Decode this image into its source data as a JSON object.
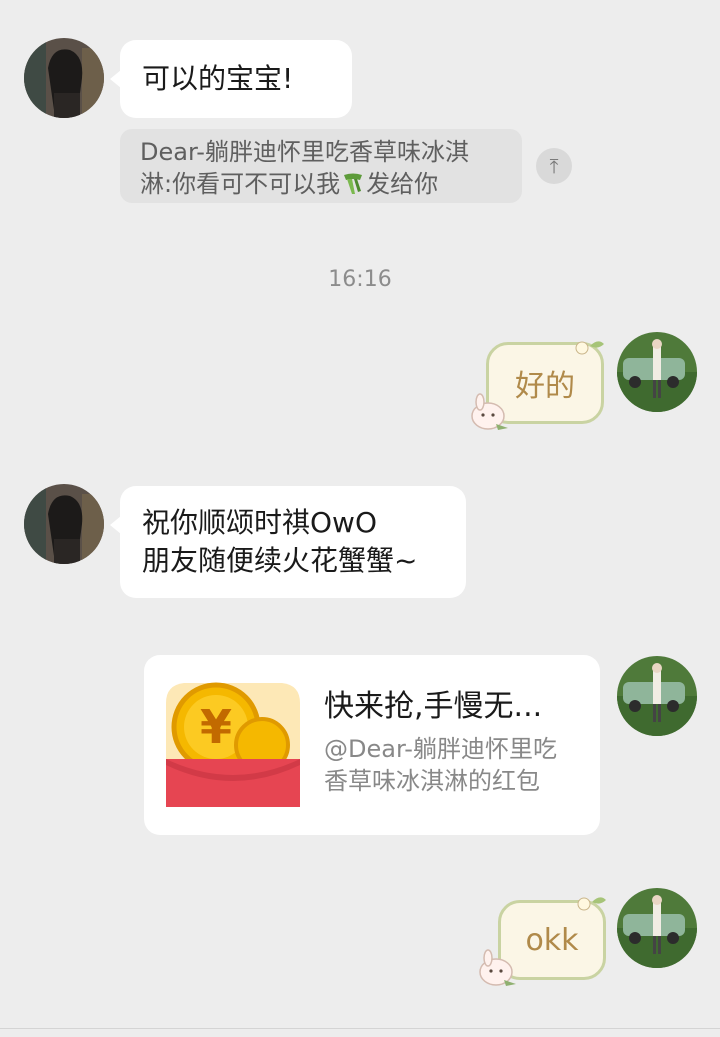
{
  "messages": {
    "m1": {
      "text": "可以的宝宝!"
    },
    "quote": {
      "line1": "Dear-躺胖迪怀里吃香草味冰淇",
      "line2_before": "淋:你看可不可以我",
      "line2_after": "发给你",
      "emoji": "scarf-icon"
    },
    "time": "16:16",
    "m2": {
      "text": "好的"
    },
    "m3": {
      "line1": "祝你顺颂时祺OwO",
      "line2": "朋友随便续火花蟹蟹~"
    },
    "red_packet": {
      "title": "快来抢,手慢无...",
      "sub_line1": "@Dear-躺胖迪怀里吃",
      "sub_line2": "香草味冰淇淋的红包",
      "currency_symbol": "¥"
    },
    "m4": {
      "text": "okk"
    }
  },
  "colors": {
    "background": "#ededed",
    "red_packet": "#e64552",
    "coin": "#f5b800"
  }
}
